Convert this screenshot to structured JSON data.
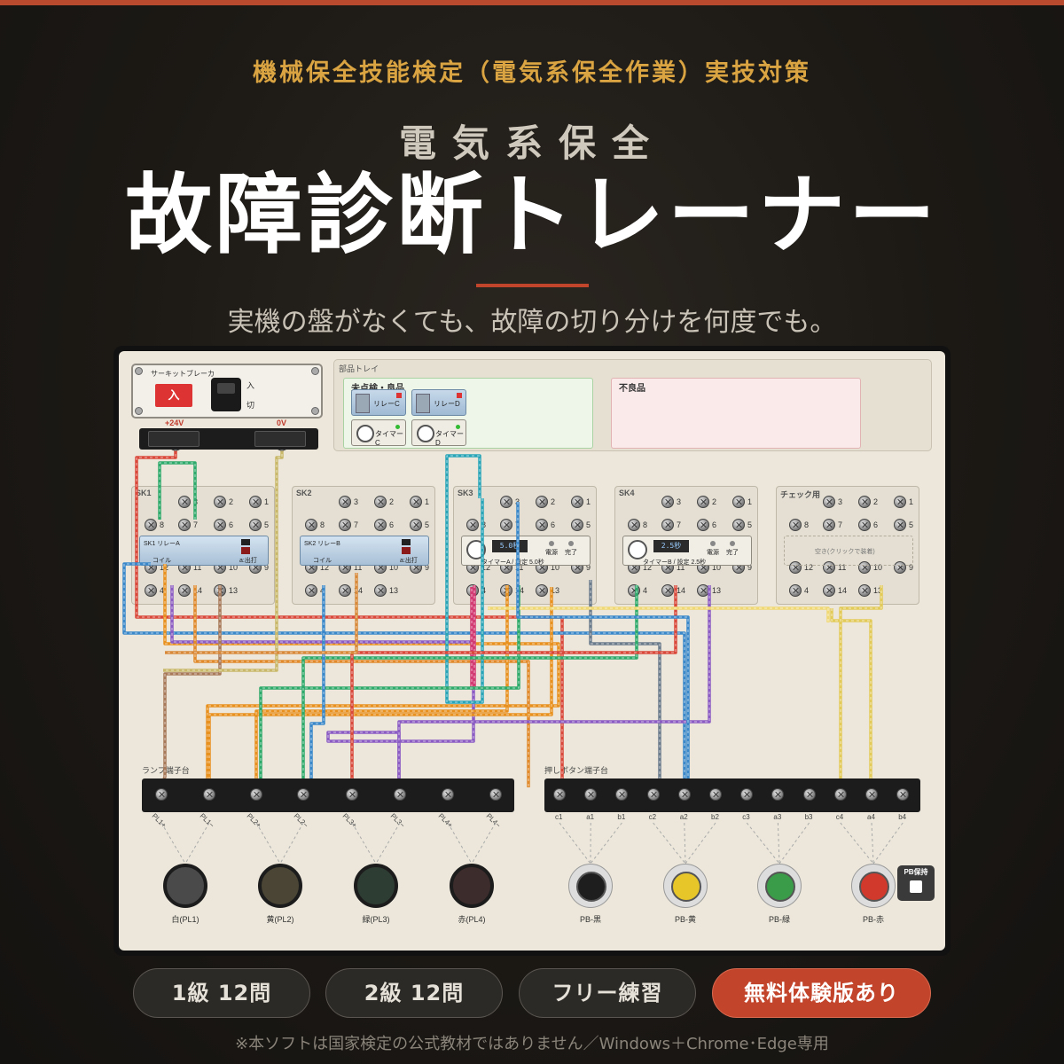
{
  "header": {
    "eyebrow": "機械保全技能検定（電気系保全作業）実技対策",
    "subtitle": "電気系保全",
    "title": "故障診断トレーナー",
    "tagline": "実機の盤がなくても、故障の切り分けを何度でも。"
  },
  "breaker": {
    "title": "サーキットブレーカ",
    "on_button": "入",
    "on_label": "入",
    "off_label": "切",
    "plus_label": "+24V",
    "zero_label": "0V"
  },
  "tray": {
    "title": "部品トレイ",
    "good_label": "未点検・良品",
    "bad_label": "不良品",
    "parts": [
      "リレーC",
      "リレーD",
      "タイマーC",
      "タイマーD"
    ]
  },
  "sockets": [
    {
      "name": "SK1",
      "device_type": "relay",
      "device_text": "SK1 リレーA",
      "coil": "コイル",
      "mode": "a:出打"
    },
    {
      "name": "SK2",
      "device_type": "relay",
      "device_text": "SK2 リレーB",
      "coil": "コイル",
      "mode": "a:出打"
    },
    {
      "name": "SK3",
      "device_type": "timer",
      "device_text": "タイマーA / 設定 5.0秒",
      "lcd": "5.0秒",
      "pwr": "電源",
      "done": "完了"
    },
    {
      "name": "SK4",
      "device_type": "timer",
      "device_text": "タイマーB / 設定 2.5秒",
      "lcd": "2.5秒",
      "pwr": "電源",
      "done": "完了"
    },
    {
      "name": "チェック用",
      "device_type": "empty",
      "device_text": "空き(クリックで装着)"
    }
  ],
  "terminal_numbers": [
    "3",
    "2",
    "1",
    "8",
    "7",
    "6",
    "5",
    "12",
    "11",
    "10",
    "9",
    "4",
    "14",
    "13"
  ],
  "lamp_block": {
    "label": "ランプ端子台",
    "terminals": [
      "PL1+",
      "PL1−",
      "PL2+",
      "PL2−",
      "PL3+",
      "PL3−",
      "PL4+",
      "PL4−"
    ]
  },
  "pb_block": {
    "label": "押しボタン端子台",
    "terminals": [
      "c1",
      "a1",
      "b1",
      "c2",
      "a2",
      "b2",
      "c3",
      "a3",
      "b3",
      "c4",
      "a4",
      "b4"
    ]
  },
  "lamps": [
    {
      "label": "白(PL1)",
      "color": "#4a4a4a"
    },
    {
      "label": "黄(PL2)",
      "color": "#4a4535"
    },
    {
      "label": "緑(PL3)",
      "color": "#2e3d33"
    },
    {
      "label": "赤(PL4)",
      "color": "#3d2c2c"
    }
  ],
  "push_buttons": [
    {
      "label": "PB-黒",
      "color": "#1e1e1e"
    },
    {
      "label": "PB-黄",
      "color": "#e6c629"
    },
    {
      "label": "PB-緑",
      "color": "#3a9c48"
    },
    {
      "label": "PB-赤",
      "color": "#d0392b"
    }
  ],
  "pb_hold": "PB保持",
  "buttons": {
    "grade1": "1級 12問",
    "grade2": "2級 12問",
    "free": "フリー練習",
    "trial": "無料体験版あり"
  },
  "footnote": "※本ソフトは国家検定の公式教材ではありません／Windows＋Chrome･Edge専用",
  "colors": {
    "accent": "#c2442b",
    "eyebrow": "#d9a441",
    "board": "#ece7da"
  }
}
